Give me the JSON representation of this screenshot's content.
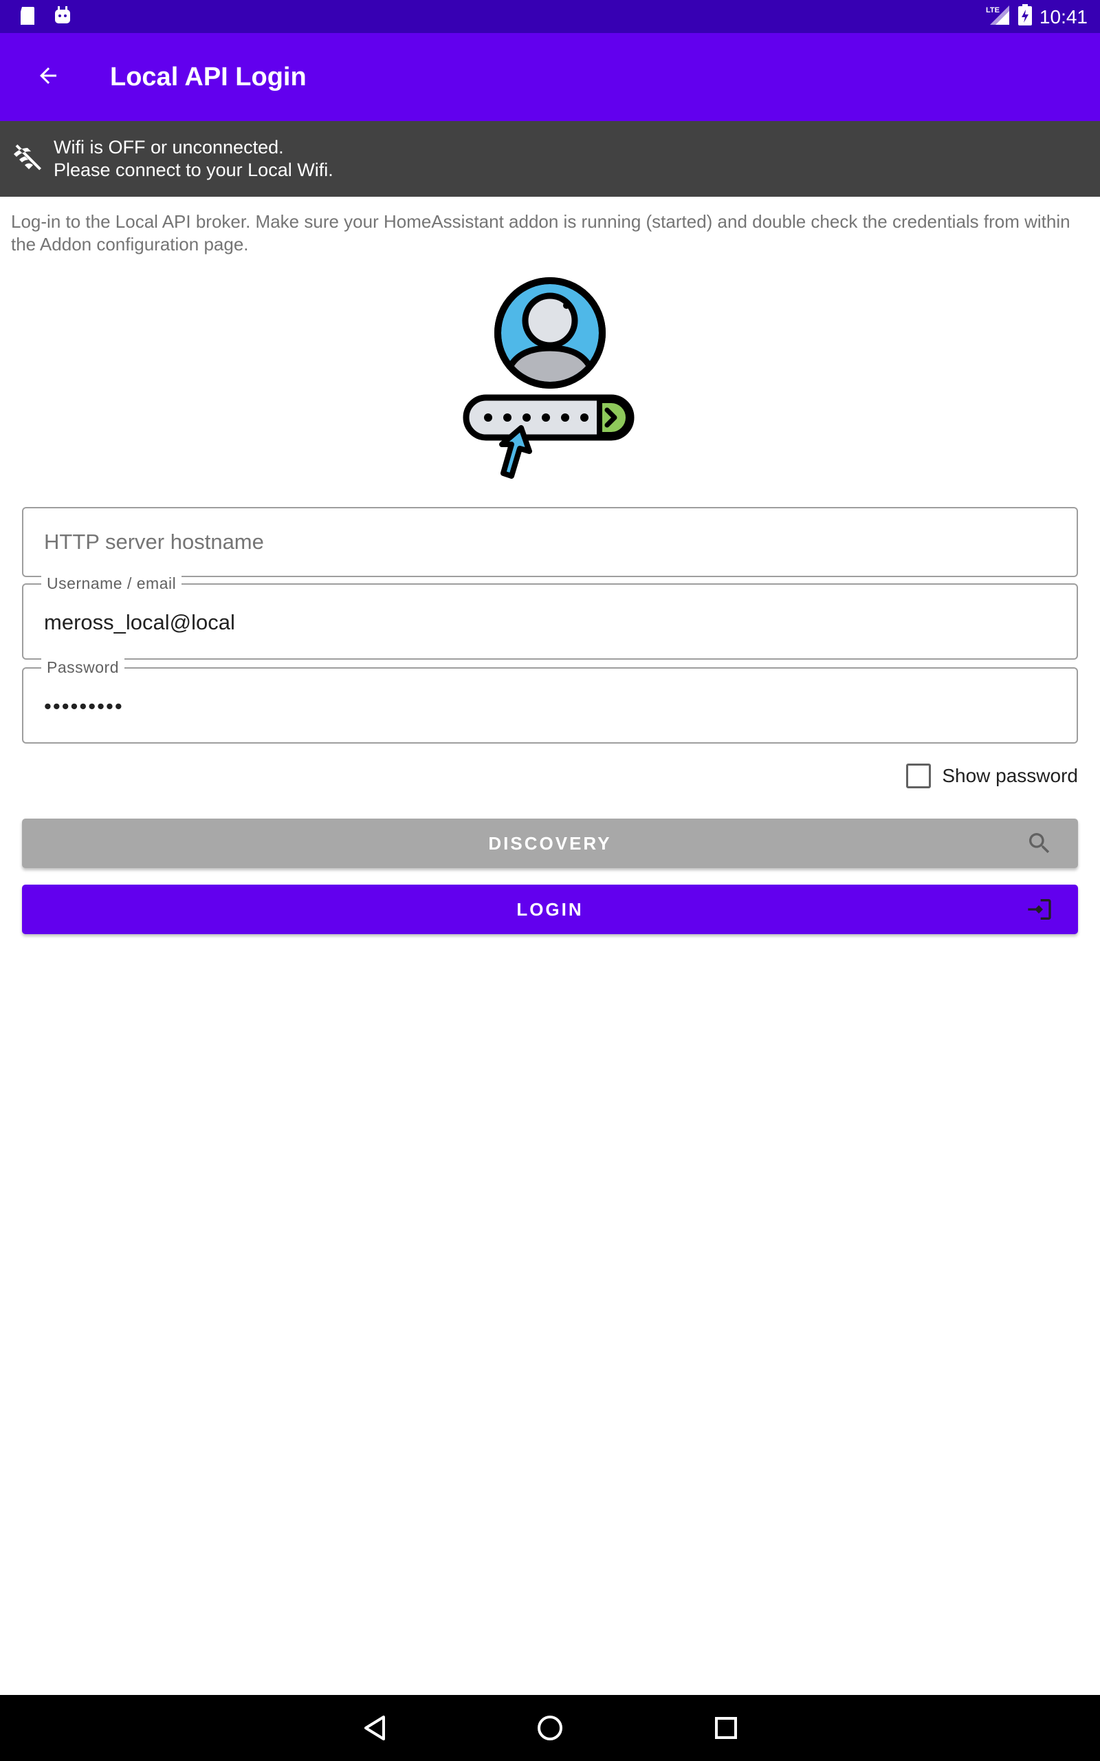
{
  "status_bar": {
    "time": "10:41",
    "network": "LTE",
    "icons": [
      "sd-card-icon",
      "android-icon",
      "signal-icon",
      "battery-charging-icon"
    ]
  },
  "app_bar": {
    "title": "Local API Login",
    "back_icon": "arrow-back-icon"
  },
  "wifi_banner": {
    "line1": "Wifi is OFF or unconnected.",
    "line2": "Please connect to your Local Wifi.",
    "icon": "wifi-off-icon"
  },
  "intro_text": "Log-in to the Local API broker. Make sure your HomeAssistant addon is running (started) and double check the credentials from within the Addon configuration page.",
  "form": {
    "hostname": {
      "placeholder": "HTTP server hostname",
      "value": ""
    },
    "username": {
      "label": "Username / email",
      "value": "meross_local@local"
    },
    "password": {
      "label": "Password",
      "value": "•••••••••"
    },
    "show_password": {
      "label": "Show password",
      "checked": false
    }
  },
  "buttons": {
    "discovery": {
      "label": "DISCOVERY",
      "icon": "search-icon"
    },
    "login": {
      "label": "LOGIN",
      "icon": "login-icon"
    }
  },
  "colors": {
    "primary": "#6200ee",
    "primary_dark": "#3700b3",
    "banner_bg": "#424242",
    "discovery_bg": "#a8a8a8"
  }
}
